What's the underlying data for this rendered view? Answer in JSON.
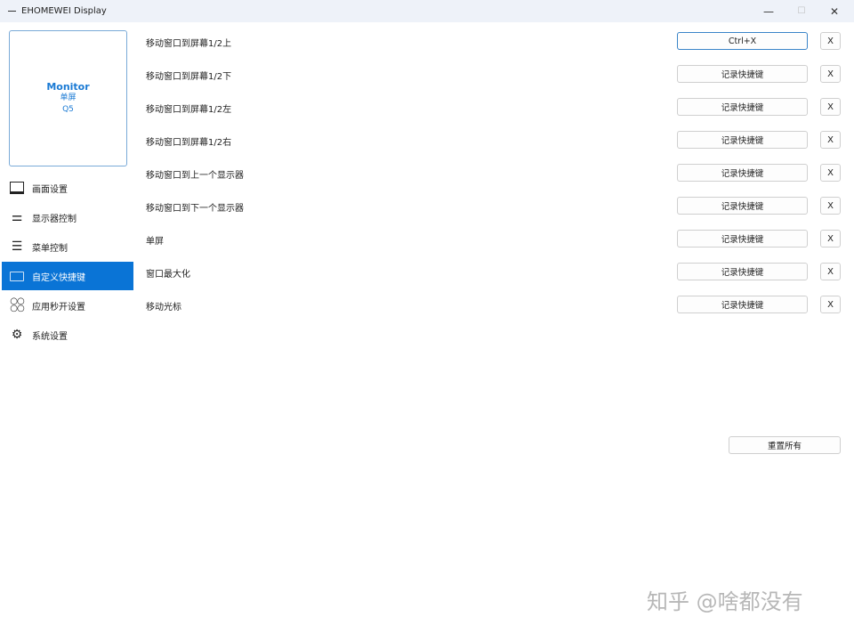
{
  "window": {
    "title": "EHOMEWEI Display",
    "minimize": "—",
    "maximize": "☐",
    "close": "✕"
  },
  "monitor_card": {
    "name": "Monitor",
    "mode": "单屏",
    "model": "Q5"
  },
  "sidebar": {
    "items": [
      {
        "label": "画面设置",
        "icon": "monitor-icon"
      },
      {
        "label": "显示器控制",
        "icon": "sliders-icon"
      },
      {
        "label": "菜单控制",
        "icon": "menu-icon"
      },
      {
        "label": "自定义快捷键",
        "icon": "keyboard-icon",
        "active": true
      },
      {
        "label": "应用秒开设置",
        "icon": "apps-icon"
      },
      {
        "label": "系统设置",
        "icon": "gear-icon"
      }
    ]
  },
  "shortcuts": [
    {
      "label": "移动窗口到屏幕1/2上",
      "value": "Ctrl+X",
      "clear": "X"
    },
    {
      "label": "移动窗口到屏幕1/2下",
      "value": "记录快捷键",
      "clear": "X"
    },
    {
      "label": "移动窗口到屏幕1/2左",
      "value": "记录快捷键",
      "clear": "X"
    },
    {
      "label": "移动窗口到屏幕1/2右",
      "value": "记录快捷键",
      "clear": "X"
    },
    {
      "label": "移动窗口到上一个显示器",
      "value": "记录快捷键",
      "clear": "X"
    },
    {
      "label": "移动窗口到下一个显示器",
      "value": "记录快捷键",
      "clear": "X"
    },
    {
      "label": "单屏",
      "value": "记录快捷键",
      "clear": "X"
    },
    {
      "label": "窗口最大化",
      "value": "记录快捷键",
      "clear": "X"
    },
    {
      "label": "移动光标",
      "value": "记录快捷键",
      "clear": "X"
    }
  ],
  "reset_label": "重置所有",
  "watermark": "知乎 @啥都没有"
}
